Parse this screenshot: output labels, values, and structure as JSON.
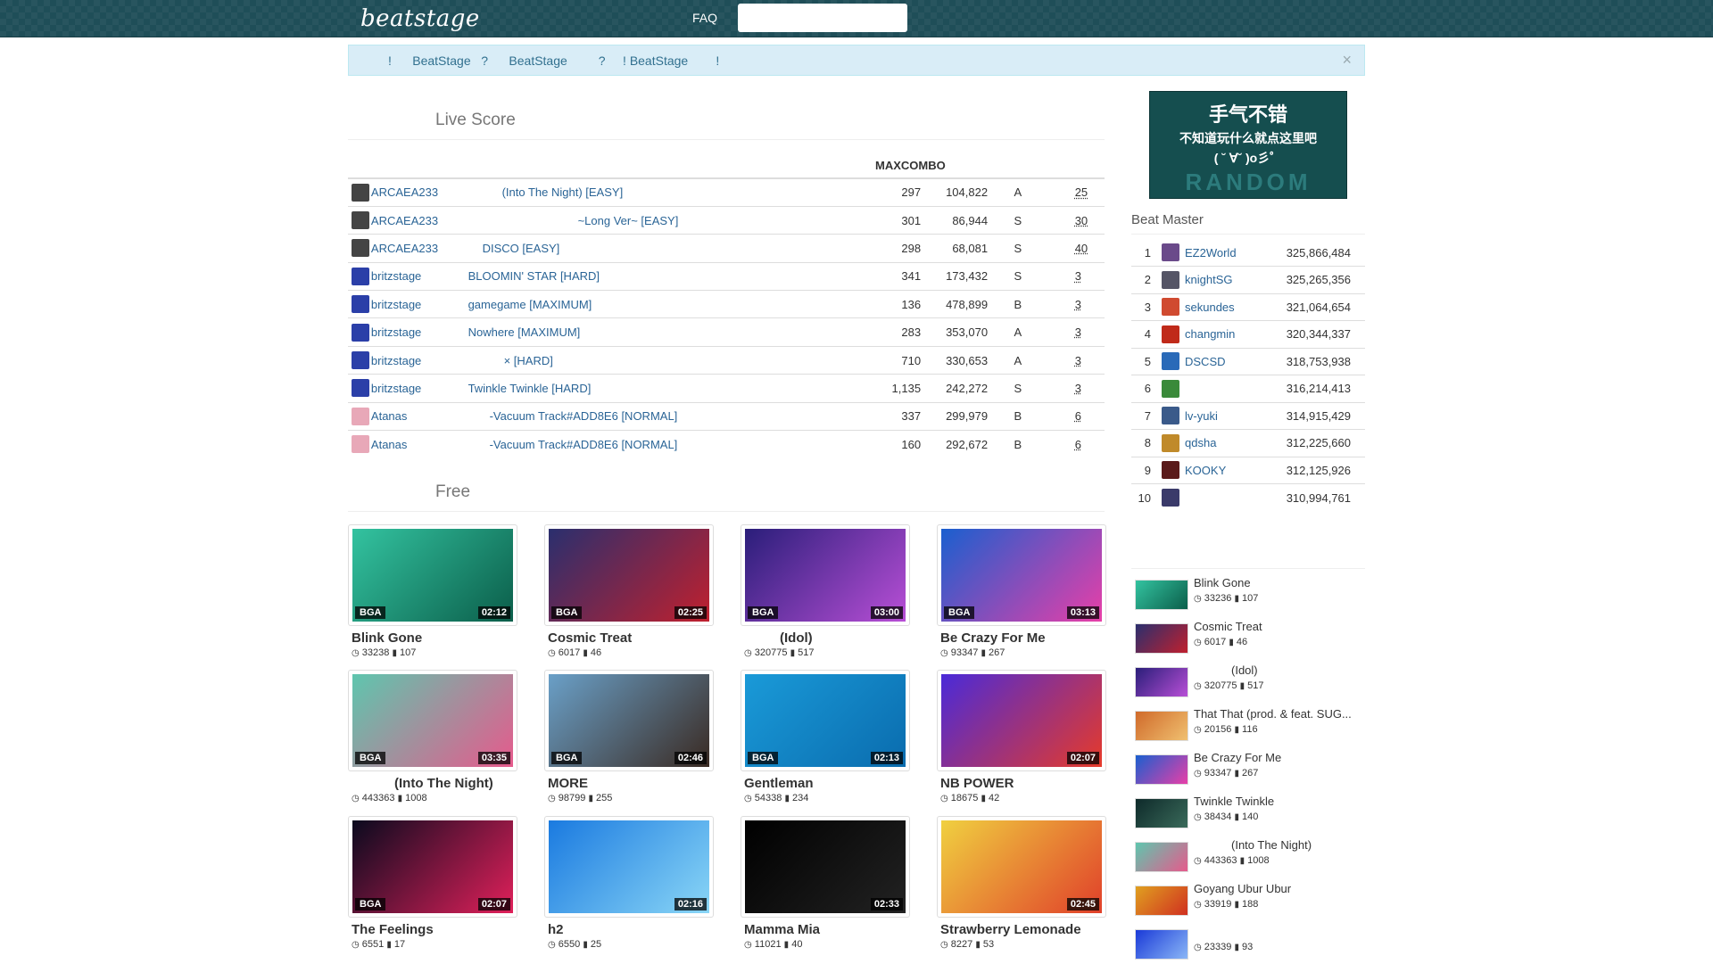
{
  "header": {
    "logo": "beatstage",
    "faq": "FAQ",
    "search_placeholder": ""
  },
  "alert": {
    "text": "!      BeatStage   ?      BeatStage         ?     ! BeatStage        !",
    "close": "×"
  },
  "live_score": {
    "title": "Live Score",
    "columns": [
      "MAXCOMBO"
    ],
    "rows": [
      {
        "user": "ARCAEA233",
        "song": "(Into The Night) [EASY]",
        "song_indent": 150,
        "combo": "297",
        "score": "104,822",
        "grade": "A",
        "rank": "25",
        "avatar": "#444"
      },
      {
        "user": "ARCAEA233",
        "song": "~Long Ver~ [EASY]",
        "song_indent": 235,
        "combo": "301",
        "score": "86,944",
        "grade": "S",
        "rank": "30",
        "avatar": "#444"
      },
      {
        "user": "ARCAEA233",
        "song": "DISCO [EASY]",
        "song_indent": 128,
        "combo": "298",
        "score": "68,081",
        "grade": "S",
        "rank": "40",
        "avatar": "#444"
      },
      {
        "user": "britzstage",
        "song": "BLOOMIN'   STAR [HARD]",
        "song_indent": 112,
        "combo": "341",
        "score": "173,432",
        "grade": "S",
        "rank": "3",
        "avatar": "#2b3fa8"
      },
      {
        "user": "britzstage",
        "song": "gamegame [MAXIMUM]",
        "song_indent": 112,
        "combo": "136",
        "score": "478,899",
        "grade": "B",
        "rank": "3",
        "avatar": "#2b3fa8"
      },
      {
        "user": "britzstage",
        "song": "Nowhere [MAXIMUM]",
        "song_indent": 112,
        "combo": "283",
        "score": "353,070",
        "grade": "A",
        "rank": "3",
        "avatar": "#2b3fa8"
      },
      {
        "user": "britzstage",
        "song": "×            [HARD]",
        "song_indent": 152,
        "combo": "710",
        "score": "330,653",
        "grade": "A",
        "rank": "3",
        "avatar": "#2b3fa8"
      },
      {
        "user": "britzstage",
        "song": "Twinkle Twinkle [HARD]",
        "song_indent": 112,
        "combo": "1,135",
        "score": "242,272",
        "grade": "S",
        "rank": "3",
        "avatar": "#2b3fa8"
      },
      {
        "user": "Atanas",
        "song": "-Vacuum Track#ADD8E6 [NORMAL]",
        "song_indent": 136,
        "combo": "337",
        "score": "299,979",
        "grade": "B",
        "rank": "6",
        "avatar": "#e8a8b8"
      },
      {
        "user": "Atanas",
        "song": "-Vacuum Track#ADD8E6 [NORMAL]",
        "song_indent": 136,
        "combo": "160",
        "score": "292,672",
        "grade": "B",
        "rank": "6",
        "avatar": "#e8a8b8"
      }
    ]
  },
  "free": {
    "title": "Free",
    "videos": [
      {
        "title": "Blink Gone",
        "views": "33238",
        "comments": "107",
        "bga": "BGA",
        "dur": "02:12",
        "c1": "#33c3a0",
        "c2": "#0b5e4a"
      },
      {
        "title": "Cosmic Treat",
        "views": "6017",
        "comments": "46",
        "bga": "BGA",
        "dur": "02:25",
        "c1": "#2a2f6e",
        "c2": "#c0202e"
      },
      {
        "title": "(Idol)",
        "views": "320775",
        "comments": "517",
        "bga": "BGA",
        "dur": "03:00",
        "c1": "#2a1e7a",
        "c2": "#b84fd6",
        "indent": 40
      },
      {
        "title": "Be Crazy For Me",
        "views": "93347",
        "comments": "267",
        "bga": "BGA",
        "dur": "03:13",
        "c1": "#1a5fcf",
        "c2": "#e83fa8"
      },
      {
        "title": "(Into The Night)",
        "views": "443363",
        "comments": "1008",
        "bga": "BGA",
        "dur": "03:35",
        "c1": "#5ec6ae",
        "c2": "#e65a8c",
        "indent": 48
      },
      {
        "title": "MORE",
        "views": "98799",
        "comments": "255",
        "bga": "BGA",
        "dur": "02:46",
        "c1": "#6aa0c8",
        "c2": "#3a2a22"
      },
      {
        "title": "Gentleman",
        "views": "54338",
        "comments": "234",
        "bga": "BGA",
        "dur": "02:13",
        "c1": "#1a9ad8",
        "c2": "#0a6cae"
      },
      {
        "title": "NB POWER",
        "views": "18675",
        "comments": "42",
        "bga": "",
        "dur": "02:07",
        "c1": "#4a2ad8",
        "c2": "#e63a2a"
      },
      {
        "title": "The Feelings",
        "views": "6551",
        "comments": "17",
        "bga": "BGA",
        "dur": "02:07",
        "c1": "#0a0a1e",
        "c2": "#e0205a"
      },
      {
        "title": "h2",
        "views": "6550",
        "comments": "25",
        "bga": "",
        "dur": "02:16",
        "c1": "#1a7ae0",
        "c2": "#8ad6f6"
      },
      {
        "title": "Mamma Mia",
        "views": "11021",
        "comments": "40",
        "bga": "",
        "dur": "02:33",
        "c1": "#000000",
        "c2": "#222222"
      },
      {
        "title": "Strawberry Lemonade",
        "views": "8227",
        "comments": "53",
        "bga": "",
        "dur": "02:45",
        "c1": "#f0d040",
        "c2": "#e0402a"
      }
    ]
  },
  "ad": {
    "line1": "手气不错",
    "line2": "不知道玩什么就点这里吧",
    "line3": "( ˘ ∀˘ )o彡゜",
    "line4": "RANDOM"
  },
  "beat_master": {
    "title": "Beat Master",
    "rows": [
      {
        "n": "1",
        "name": "EZ2World",
        "score": "325,866,484",
        "color": "#6a4a8a"
      },
      {
        "n": "2",
        "name": "knightSG",
        "score": "325,265,356",
        "color": "#555566"
      },
      {
        "n": "3",
        "name": "sekundes",
        "score": "321,064,654",
        "color": "#d04a30"
      },
      {
        "n": "4",
        "name": "changmin",
        "score": "320,344,337",
        "color": "#c02a1a"
      },
      {
        "n": "5",
        "name": "DSCSD",
        "score": "318,753,938",
        "color": "#2a6ab8"
      },
      {
        "n": "6",
        "name": "",
        "score": "316,214,413",
        "color": "#3a8a3a"
      },
      {
        "n": "7",
        "name": "lv-yuki",
        "score": "314,915,429",
        "color": "#3a5a8a"
      },
      {
        "n": "8",
        "name": "qdsha",
        "score": "312,225,660",
        "color": "#c08a2a"
      },
      {
        "n": "9",
        "name": "KOOKY",
        "score": "312,125,926",
        "color": "#5a1a1a"
      },
      {
        "n": "10",
        "name": "",
        "score": "310,994,761",
        "color": "#3a3a6a"
      }
    ]
  },
  "sidebar_list": [
    {
      "title": "Blink Gone",
      "views": "33236",
      "comments": "107",
      "c1": "#33c3a0",
      "c2": "#0b5e4a"
    },
    {
      "title": "Cosmic Treat",
      "views": "6017",
      "comments": "46",
      "c1": "#2a2f6e",
      "c2": "#c0202e"
    },
    {
      "title": "(Idol)",
      "views": "320775",
      "comments": "517",
      "c1": "#2a1e7a",
      "c2": "#b84fd6",
      "indent": 42
    },
    {
      "title": "That That (prod. & feat. SUG...",
      "views": "20156",
      "comments": "116",
      "c1": "#d06a2a",
      "c2": "#f0c070"
    },
    {
      "title": "Be Crazy For Me",
      "views": "93347",
      "comments": "267",
      "c1": "#1a5fcf",
      "c2": "#e83fa8"
    },
    {
      "title": "Twinkle Twinkle",
      "views": "38434",
      "comments": "140",
      "c1": "#0e2a2a",
      "c2": "#3a6a5a"
    },
    {
      "title": "(Into The Night)",
      "views": "443363",
      "comments": "1008",
      "c1": "#5ec6ae",
      "c2": "#e65a8c",
      "indent": 42
    },
    {
      "title": "Goyang Ubur Ubur",
      "views": "33919",
      "comments": "188",
      "c1": "#e0a020",
      "c2": "#d03020"
    },
    {
      "title": "",
      "views": "23339",
      "comments": "93",
      "c1": "#1a3ad8",
      "c2": "#8ab6f6"
    }
  ]
}
